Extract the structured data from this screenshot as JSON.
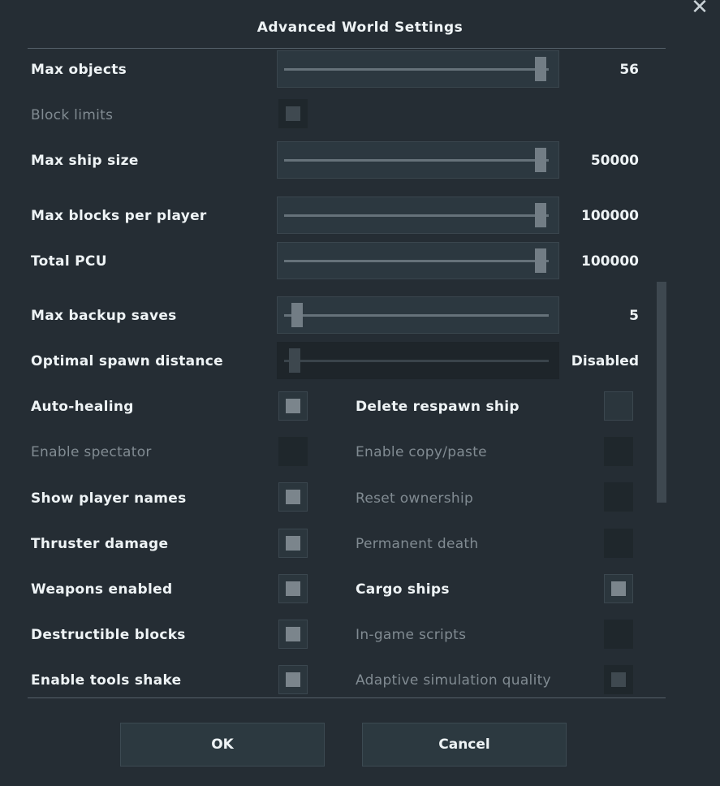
{
  "dialog": {
    "title": "Advanced World Settings",
    "close_glyph": "✕"
  },
  "sliders": [
    {
      "key": "max_objects",
      "label": "Max objects",
      "value": "56",
      "level": 0.97,
      "enabled": true
    },
    {
      "key": "max_ship_size",
      "label": "Max ship size",
      "value": "50000",
      "level": 0.97,
      "enabled": true
    },
    {
      "key": "max_blocks_per_player",
      "label": "Max blocks per player",
      "value": "100000",
      "level": 0.97,
      "enabled": true
    },
    {
      "key": "total_pcu",
      "label": "Total PCU",
      "value": "100000",
      "level": 0.97,
      "enabled": true
    },
    {
      "key": "max_backup_saves",
      "label": "Max backup saves",
      "value": "5",
      "level": 0.05,
      "enabled": true
    },
    {
      "key": "optimal_spawn_distance",
      "label": "Optimal spawn distance",
      "value": "Disabled",
      "level": 0.04,
      "enabled": false
    }
  ],
  "block_limits": {
    "label": "Block limits",
    "checked": true,
    "enabled": false
  },
  "left_checks": [
    {
      "label": "Auto-healing",
      "checked": true,
      "enabled": true
    },
    {
      "label": "Enable spectator",
      "checked": false,
      "enabled": false
    },
    {
      "label": "Show player names",
      "checked": true,
      "enabled": true
    },
    {
      "label": "Thruster damage",
      "checked": true,
      "enabled": true
    },
    {
      "label": "Weapons enabled",
      "checked": true,
      "enabled": true
    },
    {
      "label": "Destructible blocks",
      "checked": true,
      "enabled": true
    },
    {
      "label": "Enable tools shake",
      "checked": true,
      "enabled": true
    }
  ],
  "right_checks": [
    {
      "label": "Delete respawn ship",
      "checked": false,
      "enabled": true
    },
    {
      "label": "Enable copy/paste",
      "checked": false,
      "enabled": false
    },
    {
      "label": "Reset ownership",
      "checked": false,
      "enabled": false
    },
    {
      "label": "Permanent death",
      "checked": false,
      "enabled": false
    },
    {
      "label": "Cargo ships",
      "checked": true,
      "enabled": true
    },
    {
      "label": "In-game scripts",
      "checked": false,
      "enabled": false
    },
    {
      "label": "Adaptive simulation quality",
      "checked": true,
      "enabled": false
    }
  ],
  "buttons": {
    "ok": "OK",
    "cancel": "Cancel"
  },
  "colors": {
    "background": "#252d34",
    "text": "#eef3f5",
    "disabled_text": "#818b92",
    "checkbox_fill": "#7b858c"
  }
}
